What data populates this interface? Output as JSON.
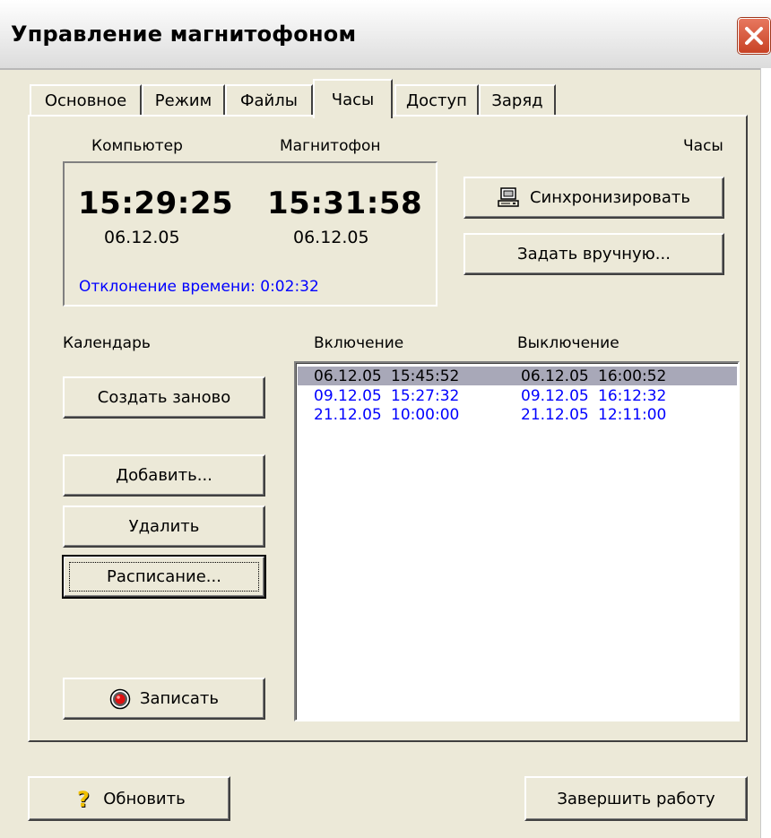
{
  "window": {
    "title": "Управление магнитофоном"
  },
  "tabs": [
    {
      "label": "Основное",
      "active": false
    },
    {
      "label": "Режим",
      "active": false
    },
    {
      "label": "Файлы",
      "active": false
    },
    {
      "label": "Часы",
      "active": true
    },
    {
      "label": "Доступ",
      "active": false
    },
    {
      "label": "Заряд",
      "active": false
    }
  ],
  "clock": {
    "computer_label": "Компьютер",
    "recorder_label": "Магнитофон",
    "clock_label": "Часы",
    "computer_time": "15:29:25",
    "computer_date": "06.12.05",
    "recorder_time": "15:31:58",
    "recorder_date": "06.12.05",
    "deviation": "Отклонение времени: 0:02:32",
    "sync_button": "Синхронизировать",
    "set_manual_button": "Задать вручную..."
  },
  "calendar": {
    "label": "Календарь",
    "recreate_button": "Создать заново",
    "add_button": "Добавить...",
    "delete_button": "Удалить",
    "schedule_button": "Расписание...",
    "record_button": "Записать"
  },
  "schedule": {
    "on_header": "Включение",
    "off_header": "Выключение",
    "rows": [
      {
        "on_date": "06.12.05",
        "on_time": "15:45:52",
        "off_date": "06.12.05",
        "off_time": "16:00:52"
      },
      {
        "on_date": "09.12.05",
        "on_time": "15:27:32",
        "off_date": "09.12.05",
        "off_time": "16:12:32"
      },
      {
        "on_date": "21.12.05",
        "on_time": "10:00:00",
        "off_date": "21.12.05",
        "off_time": "12:11:00"
      }
    ]
  },
  "footer": {
    "refresh_button": "Обновить",
    "finish_button": "Завершить работу"
  },
  "colors": {
    "face": "#ece9d8",
    "link_blue": "#0000ff",
    "selection": "#a8a8b8",
    "close_red": "#d4512f"
  },
  "icons": {
    "close": "close-x-icon",
    "sync": "computer-icon",
    "record": "record-icon",
    "refresh": "question-icon"
  }
}
